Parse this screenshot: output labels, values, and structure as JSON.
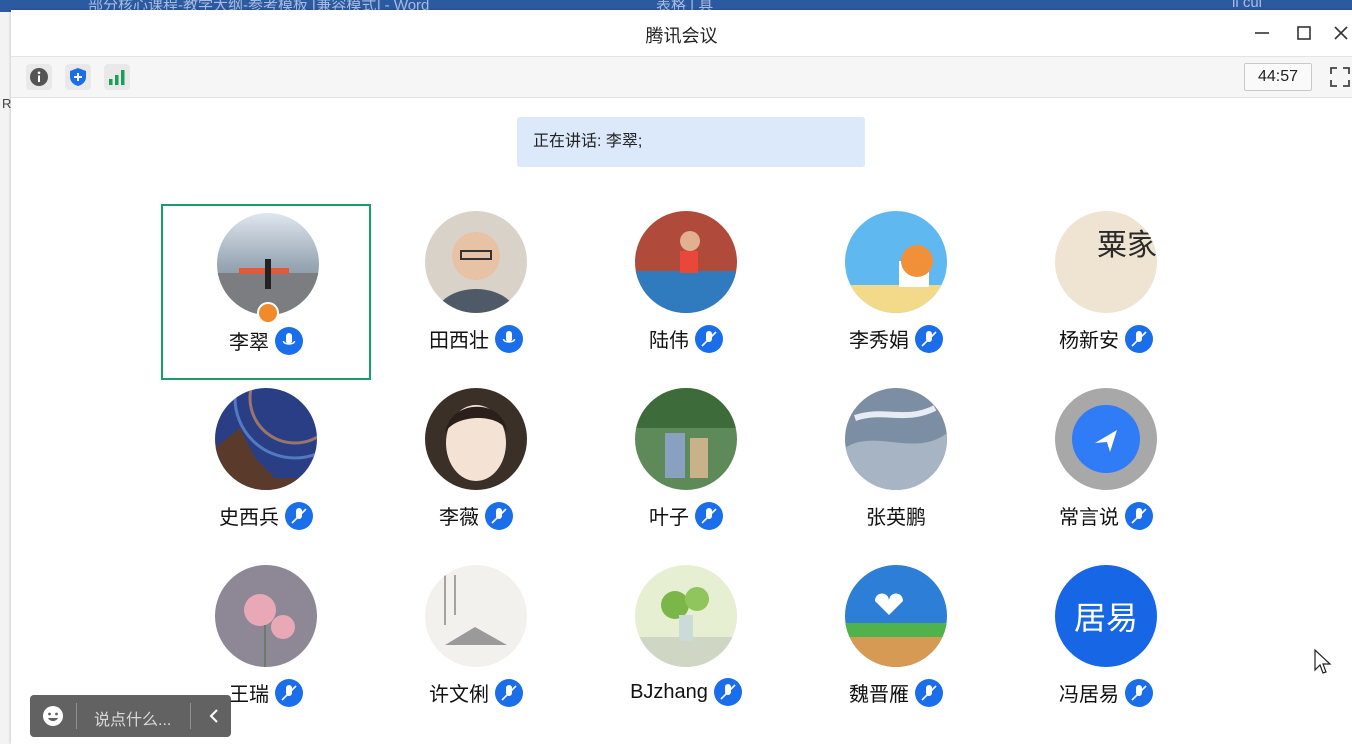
{
  "background": {
    "taskbar_left": "部分核心课程-教学大纲-参考模板 [兼容模式] - Word",
    "taskbar_mid": "表格 | 具",
    "taskbar_right": "li cui",
    "left_letter": "R"
  },
  "window": {
    "title": "腾讯会议",
    "minimize": "minimize",
    "maximize": "maximize",
    "close": "close"
  },
  "toolbar": {
    "info_icon": "info-icon",
    "shield_icon": "shield-icon",
    "signal_icon": "signal-icon",
    "timer": "44:57",
    "fullscreen_icon": "fullscreen-icon"
  },
  "speaking": {
    "text": "正在讲话: 李翠;"
  },
  "participants": [
    {
      "name": "李翠",
      "mic": "active",
      "host": true
    },
    {
      "name": "田西壮",
      "mic": "active"
    },
    {
      "name": "陆伟",
      "mic": "muted"
    },
    {
      "name": "李秀娟",
      "mic": "muted"
    },
    {
      "name": "杨新安",
      "mic": "muted"
    },
    {
      "name": "史西兵",
      "mic": "muted"
    },
    {
      "name": "李薇",
      "mic": "muted"
    },
    {
      "name": "叶子",
      "mic": "muted"
    },
    {
      "name": "张英鹏",
      "mic": "none"
    },
    {
      "name": "常言说",
      "mic": "muted"
    },
    {
      "name": "王瑞",
      "mic": "muted"
    },
    {
      "name": "许文俐",
      "mic": "muted"
    },
    {
      "name": "BJzhang",
      "mic": "muted"
    },
    {
      "name": "魏晋雁",
      "mic": "muted"
    },
    {
      "name": "冯居易",
      "mic": "muted"
    }
  ],
  "avatar_text": {
    "yangxinan": "粟家",
    "fengjuyi": "居易"
  },
  "chat": {
    "placeholder": "说点什么..."
  },
  "colors": {
    "active_border": "#14a06a",
    "mic_blue": "#1a6eea",
    "speaking_bg": "#dbe9fb"
  }
}
